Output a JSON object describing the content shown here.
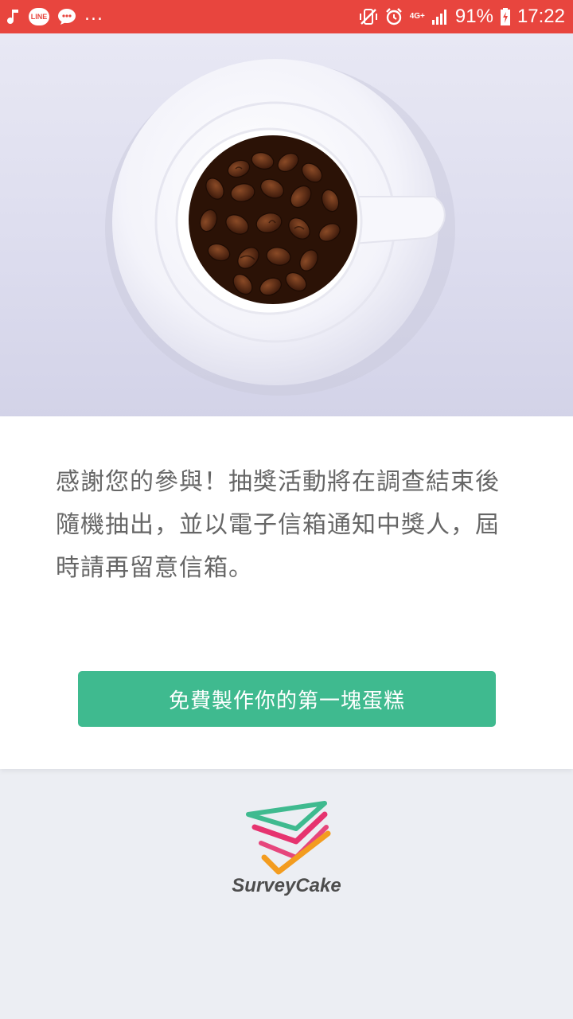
{
  "status_bar": {
    "notification_icons": [
      "music-note-icon",
      "line-app-icon",
      "chat-bubble-icon"
    ],
    "line_label": "LINE",
    "more_indicator": "...",
    "network": "4G+",
    "battery": "91%",
    "time": "17:22"
  },
  "hero": {
    "image": "coffee-beans-cup-photo"
  },
  "main": {
    "message": "感謝您的參與！抽獎活動將在調查結束後隨機抽出，並以電子信箱通知中獎人，屆時請再留意信箱。",
    "cta_label": "免費製作你的第一塊蛋糕"
  },
  "footer": {
    "brand": "SurveyCake",
    "colors": {
      "green": "#3fba8f",
      "pink": "#e6336f",
      "orange": "#f39c1f"
    }
  }
}
